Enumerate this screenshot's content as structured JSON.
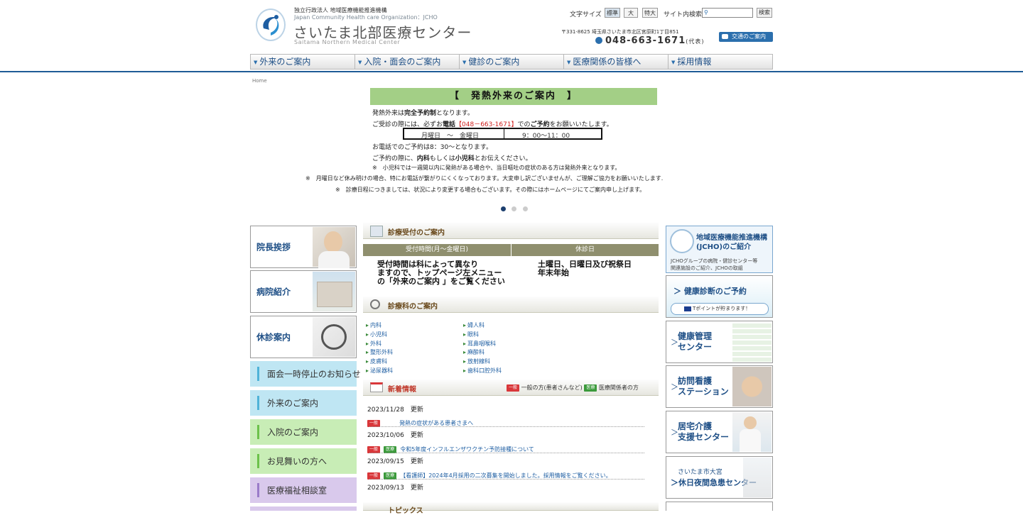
{
  "header": {
    "org_line1": "独立行政法人 地域医療機能推進機構",
    "org_line2": "Japan Community Health care Organization：JCHO",
    "site_title": "さいたま北部医療センター",
    "site_sub": "Saitama Northern Medical Center",
    "font_size_label": "文字サイズ",
    "font_sizes": [
      "標準",
      "大",
      "特大"
    ],
    "search_label": "サイト内検索",
    "search_placeholder": "",
    "search_button": "検索",
    "address": "〒331-8625 埼玉県さいたま市北区宮原町1丁目851",
    "tel": "048-663-1671",
    "tel_suffix": "(代表)",
    "access_button": "交通のご案内"
  },
  "nav": [
    "外来のご案内",
    "入院・面会のご案内",
    "健診のご案内",
    "医療関係の皆様へ",
    "採用情報"
  ],
  "breadcrumb": "Home",
  "banner": {
    "title": "【　発熱外来のご案内　】",
    "line1_pre": "発熱外来は",
    "line1_bold": "完全予約制",
    "line1_post": "となります。",
    "line2_pre": "ご受診の際には、必ずお",
    "line2_bold1": "電話",
    "line2_red": "【048－663-1671】",
    "line2_mid": "での",
    "line2_bold2": "ご予約",
    "line2_post": "をお願いいたします。",
    "hours_days": "月曜日　～　金曜日",
    "hours_time": "9：00～11：00",
    "line3": "お電話でのご予約は8：30～となります。",
    "line4_pre": "ご予約の際に、",
    "line4_bold1": "内科",
    "line4_mid": "もしくは",
    "line4_bold2": "小児科",
    "line4_post": "とお伝えください。",
    "note1": "※　小児科では一週間以内に発熱がある場合や、当日嘔吐の症状のある方は発熱外来となります。",
    "note2": "※　月曜日など休み明けの場合、特にお電話が繋がりにくくなっております。大変申し訳ございませんが、ご理解ご協力をお願いいたします.",
    "note3": "※　診療日程につきましては、状況により変更する場合もございます。その際にはホームページにてご案内申し上げます。"
  },
  "left": {
    "photo_boxes": [
      "院長挨拶",
      "病院紹介",
      "休診案内"
    ],
    "color_boxes": [
      {
        "label": "面会一時停止のお知らせ",
        "color": "#bfe6f3"
      },
      {
        "label": "外来のご案内",
        "color": "#bfe6f3"
      },
      {
        "label": "入院のご案内",
        "color": "#c8edb6"
      },
      {
        "label": "お見舞いの方へ",
        "color": "#c8edb6"
      },
      {
        "label": "医療福祉相談室",
        "color": "#d9c9ec"
      }
    ]
  },
  "reception": {
    "title": "診療受付のご案内",
    "col1": "受付時間(月～金曜日)",
    "col2": "休診日",
    "body1": [
      "受付時間は科によって異なり",
      "ますので、トップページ左メニュー",
      "の「外来のご案内 」をご覧ください"
    ],
    "body2": [
      "土曜日、日曜日及び祝祭日",
      "年末年始"
    ]
  },
  "departments": {
    "title": "診療科のご案内",
    "col1": [
      "内科",
      "小児科",
      "外科",
      "整形外科",
      "皮膚科",
      "泌尿器科"
    ],
    "col2": [
      "婦人科",
      "眼科",
      "耳鼻咽喉科",
      "麻酔科",
      "放射線科",
      "歯科口腔外科"
    ]
  },
  "news": {
    "title": "新着情報",
    "tag_general": "一般",
    "tag_medical": "医療",
    "legend_general": "一般の方(患者さんなど)",
    "legend_medical": "医療関係者の方",
    "items": [
      {
        "date": "2023/11/28　更新",
        "text": "発熱の症状がある患者さまへ",
        "medical": false
      },
      {
        "date": "2023/10/06　更新",
        "text": "令和5年度インフルエンザワクチン予防接種について",
        "medical": true
      },
      {
        "date": "2023/09/15　更新",
        "text": "【看護師】2024年4月採用の二次募集を開始しました。採用情報をご覧ください。",
        "medical": true
      },
      {
        "date": "2023/09/13　更新",
        "text": "",
        "medical": true
      }
    ]
  },
  "topics_title": "トピックス",
  "right": {
    "jcho_title": [
      "地域医療機能推進機構",
      "(JCHO)のご紹介"
    ],
    "jcho_desc": [
      "JCHOグループの病院・健診センター等",
      "関連施設のご紹介、JCHOの取組"
    ],
    "checkup_title": "健康診断のご予約",
    "tpoint": "Tポイントが貯まります！",
    "boxes": [
      [
        "健康管理",
        "センター"
      ],
      [
        "訪問看護",
        "ステーション"
      ],
      [
        "居宅介護",
        "支援センター"
      ]
    ],
    "emergency": [
      "さいたま市大宮",
      "休日夜間急患センター"
    ]
  }
}
